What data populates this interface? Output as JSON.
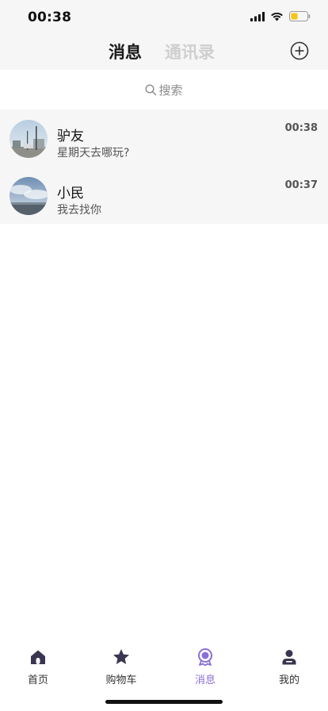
{
  "status": {
    "time": "00:38"
  },
  "header": {
    "tabs": [
      {
        "label": "消息",
        "active": true
      },
      {
        "label": "通讯录",
        "active": false
      }
    ],
    "add_icon": "plus-circle-icon"
  },
  "search": {
    "placeholder": "搜索",
    "icon": "search-icon"
  },
  "conversations": [
    {
      "name": "驴友",
      "last_message": "星期天去哪玩?",
      "time": "00:38"
    },
    {
      "name": "小民",
      "last_message": "我去找你",
      "time": "00:37"
    }
  ],
  "tabbar": {
    "items": [
      {
        "label": "首页",
        "icon": "home-icon"
      },
      {
        "label": "购物车",
        "icon": "star-icon"
      },
      {
        "label": "消息",
        "icon": "message-badge-icon",
        "active": true
      },
      {
        "label": "我的",
        "icon": "user-icon"
      }
    ],
    "active_color": "#8a6fd6"
  }
}
